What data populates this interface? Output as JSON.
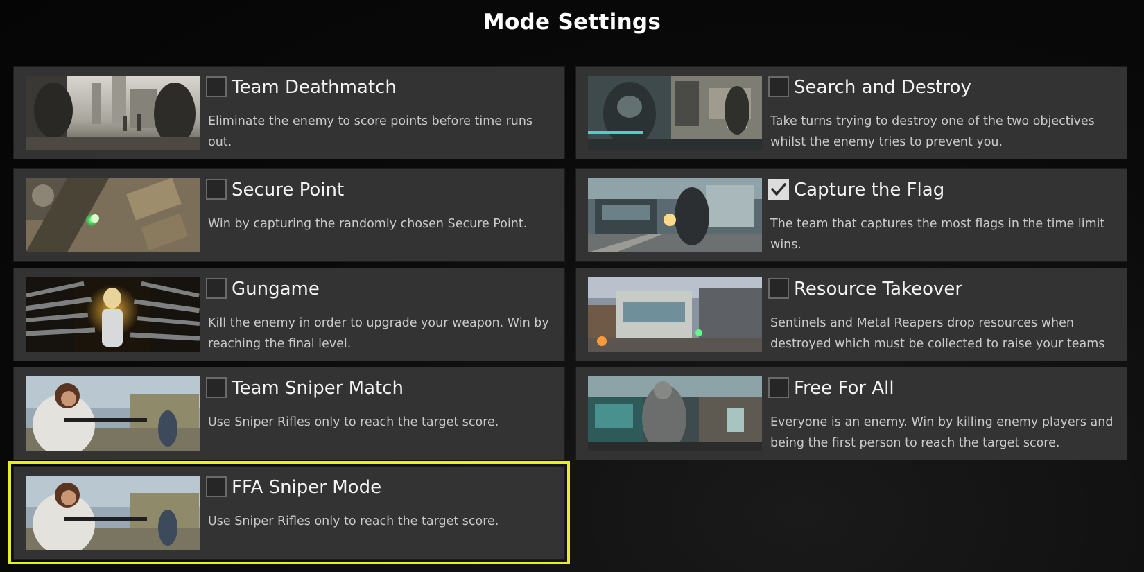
{
  "screen": {
    "title": "Mode Settings"
  },
  "modes": [
    {
      "name": "Team Deathmatch",
      "description": "Eliminate the enemy to score points before time runs out.",
      "checked": false,
      "selected": false,
      "thumbnail_icon": "soldiers-street-thumbnail"
    },
    {
      "name": "Search and Destroy",
      "description": "Take turns trying to destroy one of the two objectives whilst the enemy tries to prevent you.",
      "checked": false,
      "selected": false,
      "thumbnail_icon": "robot-soldier-thumbnail"
    },
    {
      "name": "Secure Point",
      "description": "Win by capturing the randomly chosen Secure Point.",
      "checked": false,
      "selected": false,
      "thumbnail_icon": "aerial-point-thumbnail"
    },
    {
      "name": "Capture the Flag",
      "description": "The team that captures the most flags in the time limit wins.",
      "checked": true,
      "selected": false,
      "thumbnail_icon": "station-soldier-thumbnail"
    },
    {
      "name": "Gungame",
      "description": "Kill the enemy in order to upgrade your weapon. Win by reaching the final level.",
      "checked": false,
      "selected": false,
      "thumbnail_icon": "weapons-arsenal-thumbnail"
    },
    {
      "name": "Resource Takeover",
      "description": "Sentinels and Metal Reapers drop resources when destroyed which must be collected to raise your teams",
      "checked": false,
      "selected": false,
      "thumbnail_icon": "building-battle-thumbnail"
    },
    {
      "name": "Team Sniper Match",
      "description": "Use Sniper Rifles only to reach the target score.",
      "checked": false,
      "selected": false,
      "thumbnail_icon": "sniper-woman-thumbnail"
    },
    {
      "name": "Free For All",
      "description": "Everyone is an enemy. Win by killing enemy players and being the first person to reach the target score.",
      "checked": false,
      "selected": false,
      "thumbnail_icon": "armored-soldier-thumbnail"
    },
    {
      "name": "FFA Sniper Mode",
      "description": "Use Sniper Rifles only to reach the target score.",
      "checked": false,
      "selected": true,
      "thumbnail_icon": "sniper-woman-thumbnail"
    }
  ],
  "colors": {
    "selection_outline": "#e8ef1f",
    "card_background": "#333333",
    "page_background": "#080808"
  }
}
